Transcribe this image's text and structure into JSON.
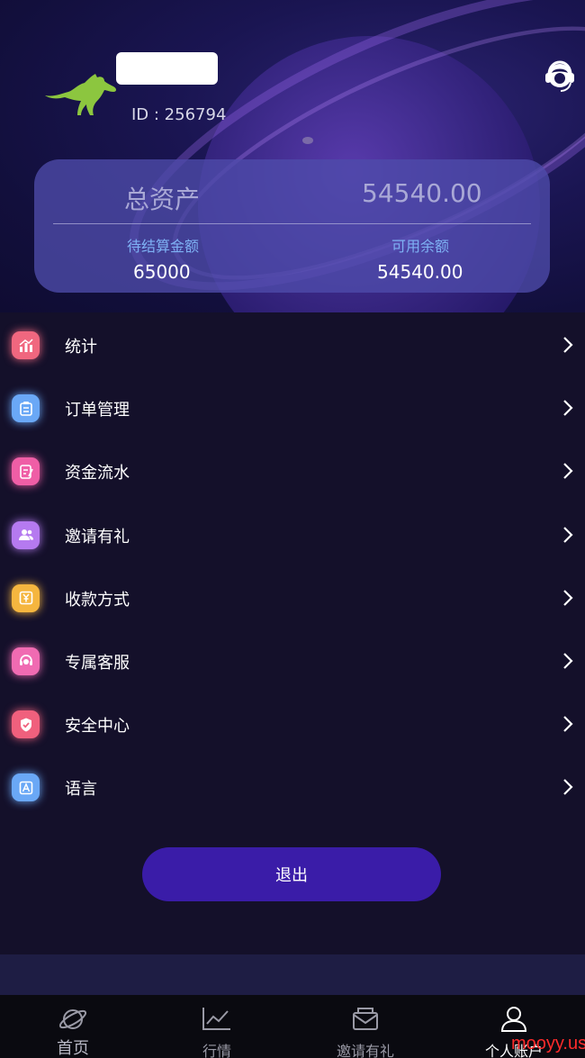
{
  "header": {
    "user_id_text": "ID : 256794"
  },
  "assets": {
    "total_label": "总资产",
    "total_value": "54540.00",
    "pending_label": "待结算金额",
    "pending_value": "65000",
    "available_label": "可用余额",
    "available_value": "54540.00"
  },
  "menu": {
    "items": [
      {
        "label": "统计",
        "icon": "statistics-icon",
        "color": "#f0677f"
      },
      {
        "label": "订单管理",
        "icon": "order-icon",
        "color": "#6aa8f6"
      },
      {
        "label": "资金流水",
        "icon": "fund-flow-icon",
        "color": "#ef5ea6"
      },
      {
        "label": "邀请有礼",
        "icon": "invite-icon",
        "color": "#b57af0"
      },
      {
        "label": "收款方式",
        "icon": "payment-method-icon",
        "color": "#f5b63f"
      },
      {
        "label": "专属客服",
        "icon": "customer-service-icon",
        "color": "#f06bb2"
      },
      {
        "label": "安全中心",
        "icon": "shield-icon",
        "color": "#f0607d"
      },
      {
        "label": "语言",
        "icon": "language-icon",
        "color": "#6aa8f6"
      }
    ]
  },
  "logout_label": "退出",
  "tabbar": {
    "tabs": [
      {
        "label": "首页",
        "icon": "planet-icon"
      },
      {
        "label": "行情",
        "icon": "chart-icon"
      },
      {
        "label": "邀请有礼",
        "icon": "mail-icon"
      },
      {
        "label": "个人账户",
        "icon": "person-icon",
        "active": true
      }
    ]
  },
  "watermark": "mooyy.us"
}
